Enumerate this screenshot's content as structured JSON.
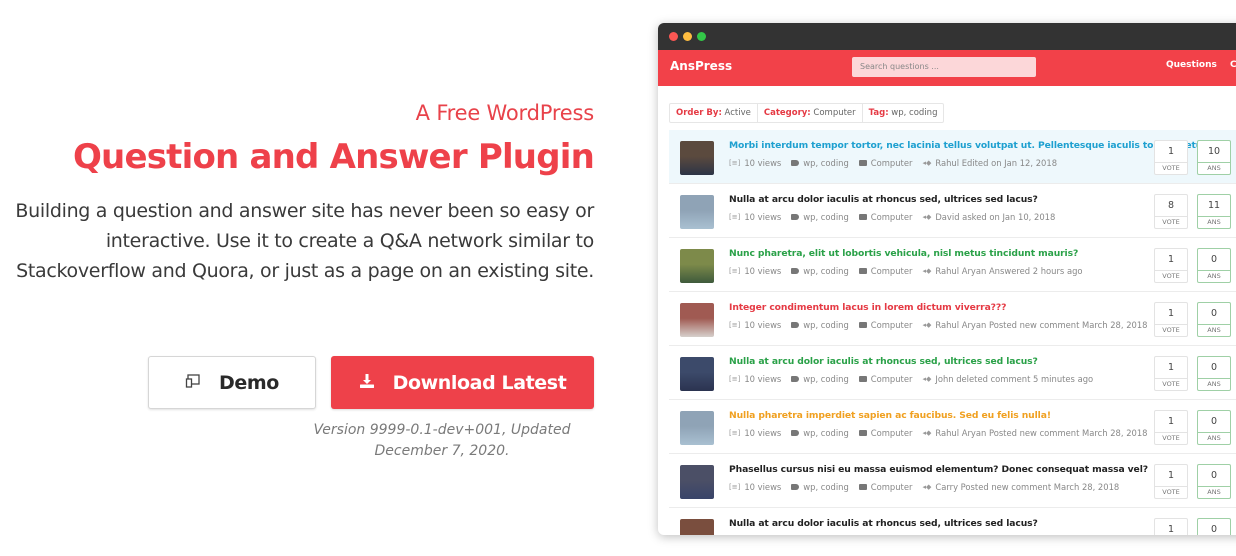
{
  "hero": {
    "subtitle": "A Free WordPress",
    "title": "Question and Answer Plugin",
    "description": "Building a question and answer site has never been so easy or interactive. Use it to create a Q&A network similar to Stackoverflow and Quora, or just as a page on an existing site.",
    "demo_label": "Demo",
    "download_label": "Download Latest",
    "version_text": "Version 9999-0.1-dev+001, Updated December 7, 2020.",
    "accent_color": "#ee414a"
  },
  "mockup": {
    "brand": "AnsPress",
    "search_placeholder": "Search questions ...",
    "nav": [
      "Questions",
      "Ca"
    ],
    "filters": [
      {
        "label": "Order By:",
        "value": "Active"
      },
      {
        "label": "Category:",
        "value": "Computer"
      },
      {
        "label": "Tag:",
        "value": "wp, coding"
      }
    ],
    "questions": [
      {
        "title": "Morbi interdum tempor tortor, nec lacinia tellus volutpat ut. Pellentesque iaculis tortor metus.",
        "color": "blue",
        "views": "10 views",
        "tags": "wp, coding",
        "category": "Computer",
        "activity": "Rahul Edited on Jan 12, 2018",
        "votes": "1",
        "vote_label": "VOTE",
        "answers": "10",
        "ans_label": "ANS",
        "highlight": true
      },
      {
        "title": "Nulla at arcu dolor iaculis at rhoncus sed, ultrices sed lacus?",
        "color": "black",
        "views": "10 views",
        "tags": "wp, coding",
        "category": "Computer",
        "activity": "David asked on Jan 10, 2018",
        "votes": "8",
        "vote_label": "VOTE",
        "answers": "11",
        "ans_label": "ANS"
      },
      {
        "title": "Nunc pharetra, elit ut lobortis vehicula, nisl metus tincidunt mauris?",
        "color": "green",
        "views": "10 views",
        "tags": "wp, coding",
        "category": "Computer",
        "activity": "Rahul Aryan Answered 2 hours ago",
        "votes": "1",
        "vote_label": "VOTE",
        "answers": "0",
        "ans_label": "ANS"
      },
      {
        "title": "Integer condimentum lacus in lorem dictum viverra???",
        "color": "red",
        "views": "10 views",
        "tags": "wp, coding",
        "category": "Computer",
        "activity": "Rahul Aryan Posted new comment March 28, 2018",
        "votes": "1",
        "vote_label": "VOTE",
        "answers": "0",
        "ans_label": "ANS"
      },
      {
        "title": "Nulla at arcu dolor iaculis at rhoncus sed, ultrices sed lacus?",
        "color": "green",
        "views": "10 views",
        "tags": "wp, coding",
        "category": "Computer",
        "activity": "John deleted comment 5 minutes ago",
        "votes": "1",
        "vote_label": "VOTE",
        "answers": "0",
        "ans_label": "ANS"
      },
      {
        "title": "Nulla pharetra imperdiet sapien ac faucibus. Sed eu felis nulla!",
        "color": "orange",
        "views": "10 views",
        "tags": "wp, coding",
        "category": "Computer",
        "activity": "Rahul Aryan Posted new comment March 28, 2018",
        "votes": "1",
        "vote_label": "VOTE",
        "answers": "0",
        "ans_label": "ANS"
      },
      {
        "title": "Phasellus cursus nisi eu massa euismod elementum? Donec consequat massa vel?",
        "color": "black",
        "views": "10 views",
        "tags": "wp, coding",
        "category": "Computer",
        "activity": "Carry Posted new comment March 28, 2018",
        "votes": "1",
        "vote_label": "VOTE",
        "answers": "0",
        "ans_label": "ANS"
      },
      {
        "title": "Nulla at arcu dolor iaculis at rhoncus sed, ultrices sed lacus?",
        "color": "black",
        "views": "",
        "tags": "",
        "category": "",
        "activity": "",
        "votes": "1",
        "vote_label": "",
        "answers": "0",
        "ans_label": ""
      }
    ]
  }
}
